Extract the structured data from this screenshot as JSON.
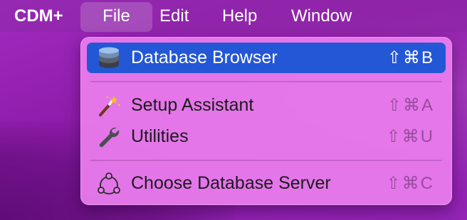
{
  "menubar": {
    "app_name": "CDM+",
    "items": [
      {
        "label": "File"
      },
      {
        "label": "Edit"
      },
      {
        "label": "Help"
      },
      {
        "label": "Window"
      }
    ]
  },
  "file_menu": {
    "items": [
      {
        "label": "Database Browser",
        "shortcut": "⇧⌘B",
        "icon": "database-icon",
        "selected": true
      },
      {
        "label": "Setup Assistant",
        "shortcut": "⇧⌘A",
        "icon": "magic-wand-icon",
        "selected": false
      },
      {
        "label": "Utilities",
        "shortcut": "⇧⌘U",
        "icon": "wrench-icon",
        "selected": false
      },
      {
        "label": "Choose Database Server",
        "shortcut": "⇧⌘C",
        "icon": "network-icon",
        "selected": false
      }
    ]
  },
  "colors": {
    "selection": "#2457d6",
    "menu_background": "#eb7dee",
    "desktop": "#9424b6"
  }
}
